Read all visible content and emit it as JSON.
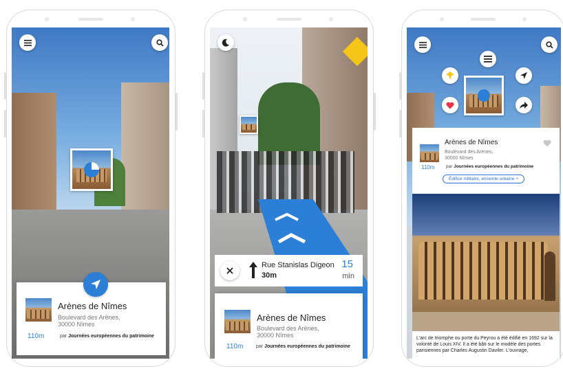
{
  "poi": {
    "name": "Arènes de Nîmes",
    "address_line1": "Boulevard des Arènes,",
    "address_line2": "30000 Nîmes",
    "distance": "110m",
    "by_prefix": "par",
    "by_org": "Journées européennes du patrimoine",
    "category_tag": "Édifice militaire, enceinte urbaine +"
  },
  "navigation": {
    "street": "Rue Stanislas Digeon",
    "step_distance": "30m",
    "eta_value": "15",
    "eta_unit": "min"
  },
  "detail": {
    "description": "L'arc de triomphe ou porte du Peyrou a été édifié en 1692 sur la volonté de Louis XIV. Il a été bâti sur le modèle des portes parisiennes par Charles Augustin Daviler. L'ouvrage,"
  },
  "colors": {
    "accent": "#2b7fd6",
    "heart": "#e8334a",
    "pin": "#f5c518"
  },
  "icons": [
    "menu-icon",
    "search-icon",
    "moon-icon",
    "close-icon",
    "arrow-up-icon",
    "navigate-icon",
    "pin-icon",
    "heart-icon",
    "list-icon",
    "share-icon",
    "like-icon"
  ]
}
